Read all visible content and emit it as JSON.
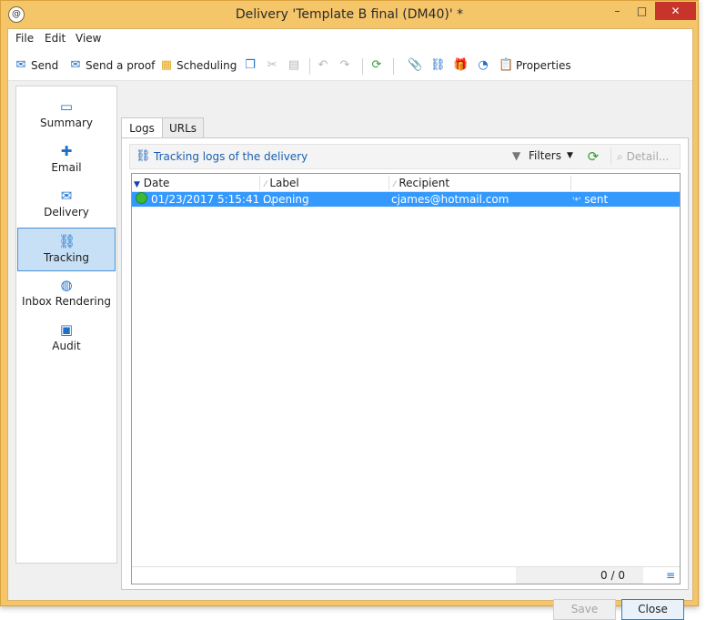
{
  "window": {
    "title": "Delivery 'Template B final (DM40)' *",
    "app_icon": "@",
    "controls": {
      "minimize": "–",
      "maximize": "□",
      "close": "✕"
    }
  },
  "menu": [
    "File",
    "Edit",
    "View"
  ],
  "toolbar": {
    "send": "Send",
    "send_proof": "Send a proof",
    "scheduling": "Scheduling",
    "properties": "Properties"
  },
  "sidebar": {
    "items": [
      {
        "label": "Summary",
        "icon": "summary-icon",
        "active": false
      },
      {
        "label": "Email",
        "icon": "email-icon",
        "active": false
      },
      {
        "label": "Delivery",
        "icon": "delivery-icon",
        "active": false
      },
      {
        "label": "Tracking",
        "icon": "tracking-icon",
        "active": true
      },
      {
        "label": "Inbox Rendering",
        "icon": "globe-icon",
        "active": false
      },
      {
        "label": "Audit",
        "icon": "audit-icon",
        "active": false
      }
    ]
  },
  "tabs": [
    {
      "label": "Logs",
      "active": true
    },
    {
      "label": "URLs",
      "active": false
    }
  ],
  "logs": {
    "title": "Tracking logs of the delivery",
    "filters": "Filters",
    "detail": "Detail...",
    "columns": [
      "Date",
      "Label",
      "Recipient"
    ],
    "rows": [
      {
        "date": "01/23/2017 5:15:41 ...",
        "label": "Opening",
        "recipient": "cjames@hotmail.com",
        "status_marker": "'*'",
        "status": "sent"
      }
    ],
    "count": "0 / 0"
  },
  "buttons": {
    "save": "Save",
    "close": "Close"
  },
  "colors": {
    "titlebar": "#f5c56a",
    "selection": "#3399ff",
    "link": "#1a5fb4",
    "active_sidebar": "#c7e0f6"
  }
}
